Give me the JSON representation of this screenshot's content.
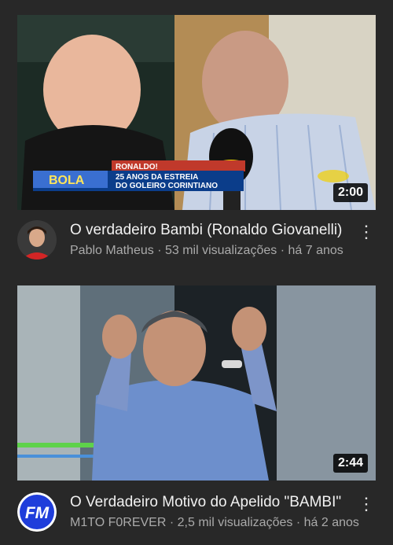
{
  "videos": [
    {
      "title": "O verdadeiro Bambi (Ronaldo Giovanelli)",
      "channel": "Pablo Matheus",
      "views": "53 mil visualizações",
      "age": "há 7 anos",
      "meta_sep": "·",
      "duration": "2:00",
      "overlay": {
        "name": "RONALDO!",
        "line1": "25 ANOS DA ESTREIA",
        "line2": "DO GOLEIRO CORINTIANO",
        "logo": "BOLA"
      }
    },
    {
      "title": "O Verdadeiro Motivo do Apelido \"BAMBI\"",
      "channel": "M1TO F0REVER",
      "views": "2,5 mil visualizações",
      "age": "há 2 anos",
      "meta_sep": "·",
      "duration": "2:44",
      "avatar_text": "FM"
    }
  ],
  "colors": {
    "background": "#282828",
    "secondary_text": "#aaaaaa",
    "fm_avatar": "#1f3ddb"
  }
}
